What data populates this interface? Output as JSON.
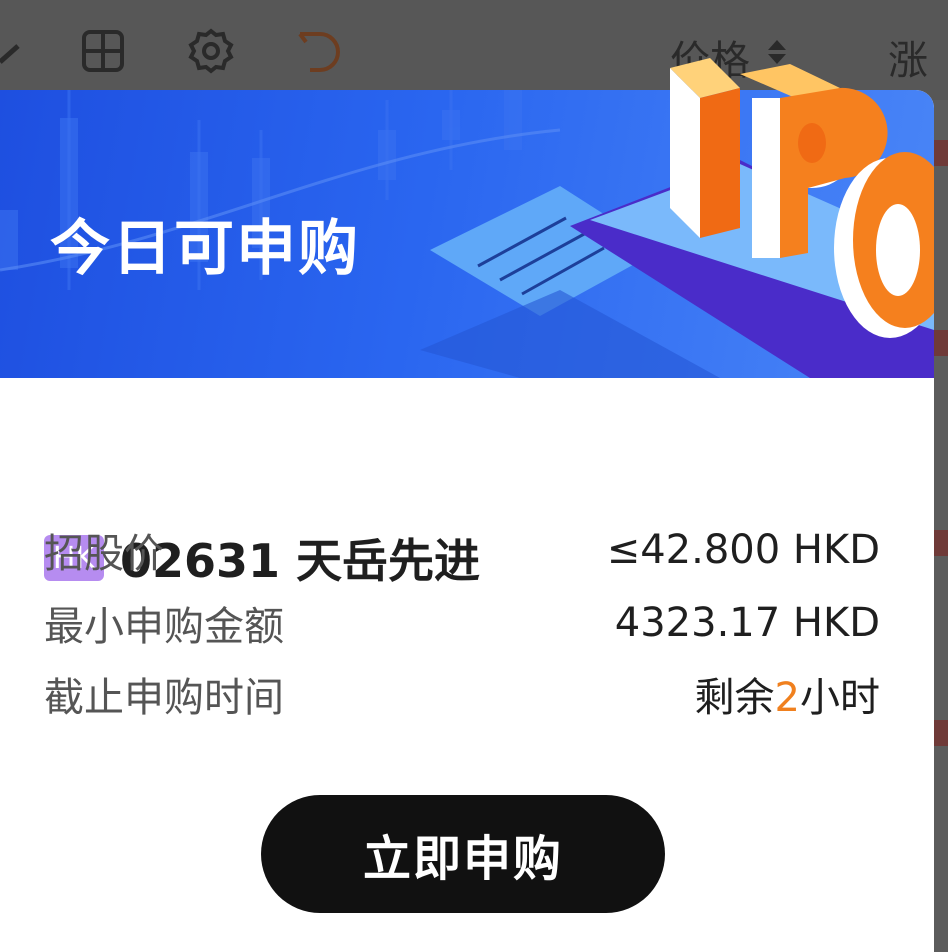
{
  "background": {
    "toolbar_icons": [
      "chevron-icon",
      "grid-icon",
      "gear-icon",
      "undo-icon"
    ],
    "col_price": "价格",
    "col_change": "涨跌"
  },
  "banner": {
    "title": "今日可申购",
    "art_text": "IPO"
  },
  "stock": {
    "market": "HK",
    "name": "02631 天岳先进"
  },
  "details": [
    {
      "label": "招股价",
      "value": "≤42.800 HKD"
    },
    {
      "label": "最小申购金额",
      "value": "4323.17 HKD"
    },
    {
      "label": "截止申购时间",
      "value_prefix": "剩余",
      "value_highlight": "2",
      "value_suffix": "小时"
    }
  ],
  "cta": {
    "label": "立即申购"
  },
  "colors": {
    "banner_blue": "#2a66f0",
    "badge_purple": "#b68cf0",
    "accent_orange": "#f0801e",
    "button_black": "#111111"
  }
}
